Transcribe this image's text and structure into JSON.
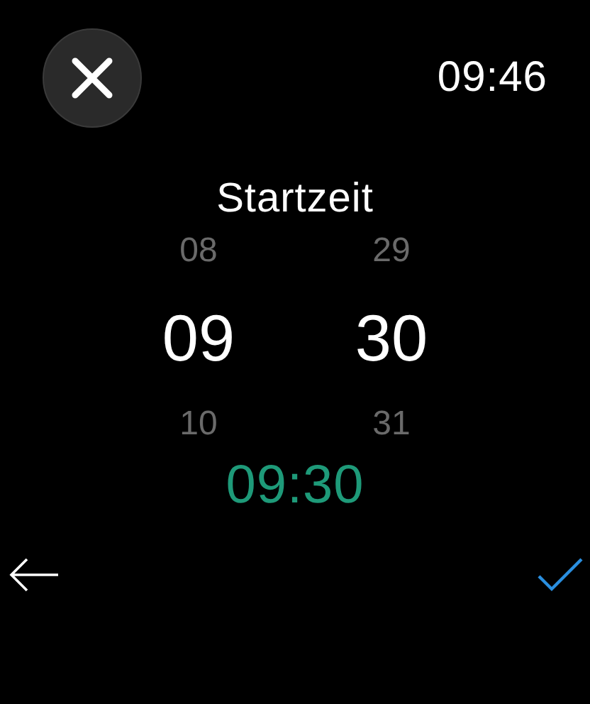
{
  "status_bar": {
    "time": "09:46"
  },
  "title": "Startzeit",
  "picker": {
    "columns": [
      {
        "items": [
          {
            "label": "08",
            "selected": false
          },
          {
            "label": "09",
            "selected": true
          },
          {
            "label": "10",
            "selected": false
          }
        ]
      },
      {
        "items": [
          {
            "label": "29",
            "selected": false
          },
          {
            "label": "30",
            "selected": true
          },
          {
            "label": "31",
            "selected": false
          }
        ]
      }
    ]
  },
  "summary": "09:30"
}
